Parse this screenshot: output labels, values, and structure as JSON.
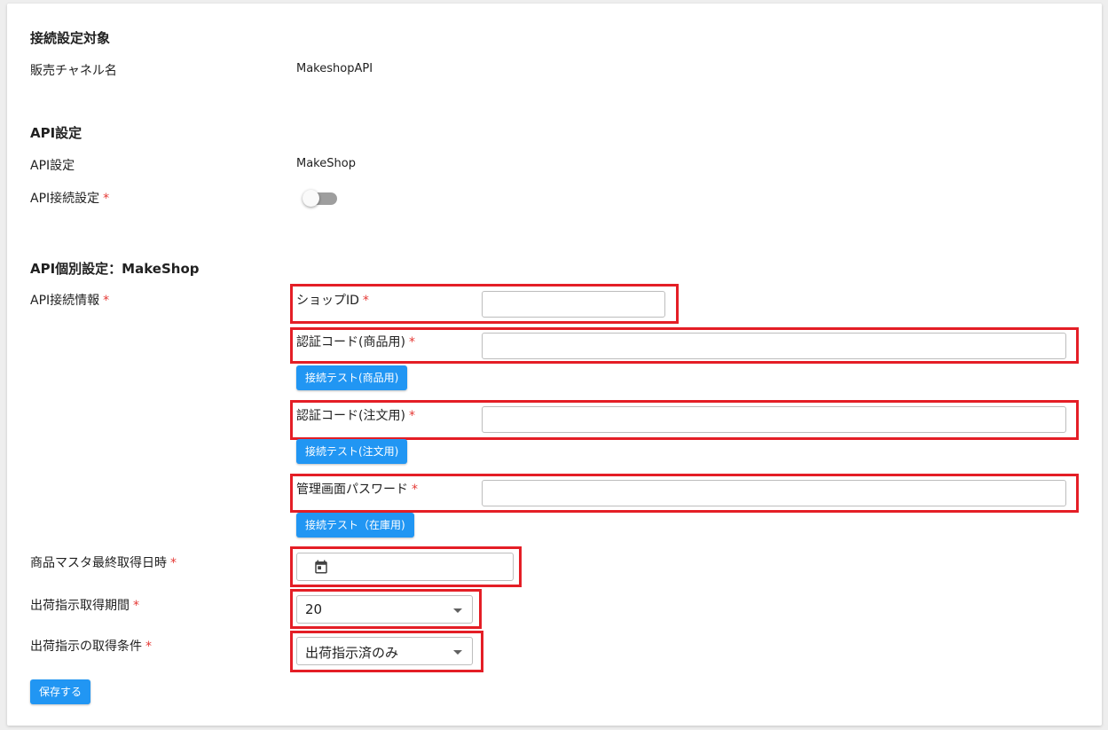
{
  "section1": {
    "title": "接続設定対象",
    "channel_label": "販売チャネル名",
    "channel_value": "MakeshopAPI"
  },
  "section2": {
    "title": "API設定",
    "api_label": "API設定",
    "api_value": "MakeShop",
    "connect_label": "API接続設定",
    "connect_enabled": false
  },
  "section3": {
    "title": "API個別設定：MakeShop",
    "info_label": "API接続情報",
    "shop_id_label": "ショップID",
    "shop_id_value": "",
    "auth_product_label": "認証コード(商品用)",
    "auth_product_value": "",
    "test_product_button": "接続テスト(商品用)",
    "auth_order_label": "認証コード(注文用)",
    "auth_order_value": "",
    "test_order_button": "接続テスト(注文用)",
    "admin_password_label": "管理画面パスワード",
    "admin_password_value": "",
    "test_stock_button": "接続テスト（在庫用)",
    "master_date_label": "商品マスタ最終取得日時",
    "master_date_value": "",
    "period_label": "出荷指示取得期間",
    "period_value": "20",
    "condition_label": "出荷指示の取得条件",
    "condition_value": "出荷指示済のみ"
  },
  "required_mark": "*",
  "save_button": "保存する",
  "colors": {
    "accent": "#2196f3",
    "required": "#e53935",
    "highlight": "#e41e26"
  }
}
